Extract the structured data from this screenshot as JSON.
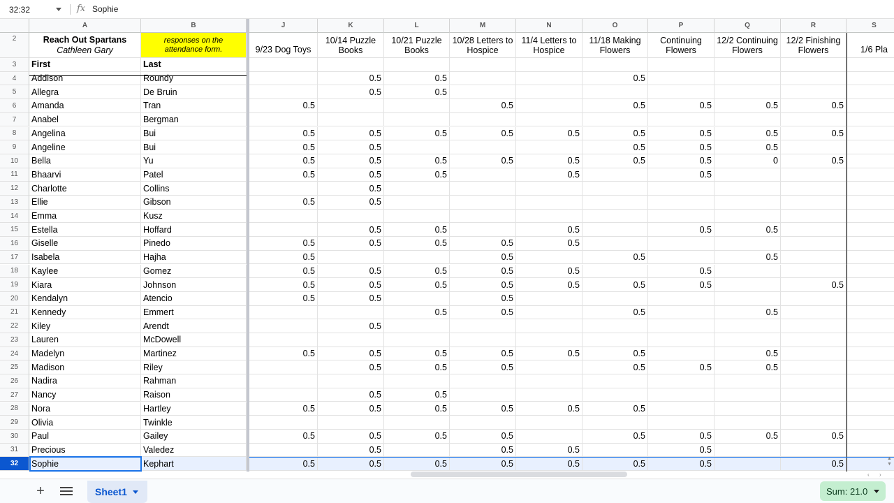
{
  "formula_bar": {
    "name_box": "32:32",
    "fx": "fx",
    "value": "Sophie"
  },
  "columns": [
    "A",
    "B",
    "J",
    "K",
    "L",
    "M",
    "N",
    "O",
    "P",
    "Q",
    "R",
    "S"
  ],
  "header_cells": {
    "a2_line1": "Reach Out Spartans",
    "a2_line2": "Cathleen Gary",
    "b2_line1": "responses on the",
    "b2_line2": "attendance form.",
    "events": [
      [
        "",
        "9/23 Dog Toys"
      ],
      [
        "10/14 Puzzle",
        "Books"
      ],
      [
        "10/21 Puzzle",
        "Books"
      ],
      [
        "10/28 Letters to",
        "Hospice"
      ],
      [
        "11/4 Letters to",
        "Hospice"
      ],
      [
        "11/18 Making",
        "Flowers"
      ],
      [
        "Continuing",
        "Flowers"
      ],
      [
        "12/2 Continuing",
        "Flowers"
      ],
      [
        "12/2 Finishing",
        "Flowers"
      ],
      [
        "",
        "1/6 Pla"
      ]
    ],
    "first_label": "First",
    "last_label": "Last"
  },
  "rows": [
    {
      "n": "4",
      "first": "Addison",
      "last": "Roundy",
      "v": [
        "",
        "0.5",
        "0.5",
        "",
        "",
        "0.5",
        "",
        "",
        ""
      ]
    },
    {
      "n": "5",
      "first": "Allegra",
      "last": "De Bruin",
      "v": [
        "",
        "0.5",
        "0.5",
        "",
        "",
        "",
        "",
        "",
        ""
      ]
    },
    {
      "n": "6",
      "first": "Amanda",
      "last": "Tran",
      "v": [
        "0.5",
        "",
        "",
        "0.5",
        "",
        "0.5",
        "0.5",
        "0.5",
        "0.5"
      ]
    },
    {
      "n": "7",
      "first": "Anabel",
      "last": "Bergman",
      "v": [
        "",
        "",
        "",
        "",
        "",
        "",
        "",
        "",
        ""
      ]
    },
    {
      "n": "8",
      "first": "Angelina",
      "last": "Bui",
      "v": [
        "0.5",
        "0.5",
        "0.5",
        "0.5",
        "0.5",
        "0.5",
        "0.5",
        "0.5",
        "0.5"
      ]
    },
    {
      "n": "9",
      "first": "Angeline",
      "last": "Bui",
      "v": [
        "0.5",
        "0.5",
        "",
        "",
        "",
        "0.5",
        "0.5",
        "0.5",
        ""
      ]
    },
    {
      "n": "10",
      "first": "Bella",
      "last": "Yu",
      "v": [
        "0.5",
        "0.5",
        "0.5",
        "0.5",
        "0.5",
        "0.5",
        "0.5",
        "0",
        "0.5"
      ]
    },
    {
      "n": "11",
      "first": "Bhaarvi",
      "last": "Patel",
      "v": [
        "0.5",
        "0.5",
        "0.5",
        "",
        "0.5",
        "",
        "0.5",
        "",
        ""
      ]
    },
    {
      "n": "12",
      "first": "Charlotte",
      "last": "Collins",
      "v": [
        "",
        "0.5",
        "",
        "",
        "",
        "",
        "",
        "",
        ""
      ]
    },
    {
      "n": "13",
      "first": "Ellie",
      "last": "Gibson",
      "v": [
        "0.5",
        "0.5",
        "",
        "",
        "",
        "",
        "",
        "",
        ""
      ]
    },
    {
      "n": "14",
      "first": "Emma",
      "last": "Kusz",
      "v": [
        "",
        "",
        "",
        "",
        "",
        "",
        "",
        "",
        ""
      ]
    },
    {
      "n": "15",
      "first": "Estella",
      "last": "Hoffard",
      "v": [
        "",
        "0.5",
        "0.5",
        "",
        "0.5",
        "",
        "0.5",
        "0.5",
        ""
      ]
    },
    {
      "n": "16",
      "first": "Giselle",
      "last": "Pinedo",
      "v": [
        "0.5",
        "0.5",
        "0.5",
        "0.5",
        "0.5",
        "",
        "",
        "",
        ""
      ]
    },
    {
      "n": "17",
      "first": "Isabela",
      "last": "Hajha",
      "v": [
        "0.5",
        "",
        "",
        "0.5",
        "",
        "0.5",
        "",
        "0.5",
        ""
      ]
    },
    {
      "n": "18",
      "first": "Kaylee",
      "last": "Gomez",
      "v": [
        "0.5",
        "0.5",
        "0.5",
        "0.5",
        "0.5",
        "",
        "0.5",
        "",
        ""
      ]
    },
    {
      "n": "19",
      "first": "Kiara",
      "last": "Johnson",
      "v": [
        "0.5",
        "0.5",
        "0.5",
        "0.5",
        "0.5",
        "0.5",
        "0.5",
        "",
        "0.5"
      ]
    },
    {
      "n": "20",
      "first": "Kendalyn",
      "last": "Atencio",
      "v": [
        "0.5",
        "0.5",
        "",
        "0.5",
        "",
        "",
        "",
        "",
        ""
      ]
    },
    {
      "n": "21",
      "first": "Kennedy",
      "last": "Emmert",
      "v": [
        "",
        "",
        "0.5",
        "0.5",
        "",
        "0.5",
        "",
        "0.5",
        ""
      ]
    },
    {
      "n": "22",
      "first": "Kiley",
      "last": "Arendt",
      "v": [
        "",
        "0.5",
        "",
        "",
        "",
        "",
        "",
        "",
        ""
      ]
    },
    {
      "n": "23",
      "first": "Lauren",
      "last": "McDowell",
      "v": [
        "",
        "",
        "",
        "",
        "",
        "",
        "",
        "",
        ""
      ]
    },
    {
      "n": "24",
      "first": "Madelyn",
      "last": "Martinez",
      "v": [
        "0.5",
        "0.5",
        "0.5",
        "0.5",
        "0.5",
        "0.5",
        "",
        "0.5",
        ""
      ]
    },
    {
      "n": "25",
      "first": "Madison",
      "last": "Riley",
      "v": [
        "",
        "0.5",
        "0.5",
        "0.5",
        "",
        "0.5",
        "0.5",
        "0.5",
        ""
      ]
    },
    {
      "n": "26",
      "first": "Nadira",
      "last": "Rahman",
      "v": [
        "",
        "",
        "",
        "",
        "",
        "",
        "",
        "",
        ""
      ]
    },
    {
      "n": "27",
      "first": "Nancy",
      "last": "Raison",
      "v": [
        "",
        "0.5",
        "0.5",
        "",
        "",
        "",
        "",
        "",
        ""
      ]
    },
    {
      "n": "28",
      "first": "Nora",
      "last": "Hartley",
      "v": [
        "0.5",
        "0.5",
        "0.5",
        "0.5",
        "0.5",
        "0.5",
        "",
        "",
        ""
      ]
    },
    {
      "n": "29",
      "first": "Olivia",
      "last": "Twinkle",
      "v": [
        "",
        "",
        "",
        "",
        "",
        "",
        "",
        "",
        ""
      ]
    },
    {
      "n": "30",
      "first": "Paul",
      "last": "Gailey",
      "v": [
        "0.5",
        "0.5",
        "0.5",
        "0.5",
        "",
        "0.5",
        "0.5",
        "0.5",
        "0.5"
      ]
    },
    {
      "n": "31",
      "first": "Precious",
      "last": "Valedez",
      "v": [
        "",
        "0.5",
        "",
        "0.5",
        "0.5",
        "",
        "0.5",
        "",
        ""
      ]
    },
    {
      "n": "32",
      "first": "Sophie",
      "last": "Kephart",
      "v": [
        "0.5",
        "0.5",
        "0.5",
        "0.5",
        "0.5",
        "0.5",
        "0.5",
        "",
        "0.5"
      ],
      "selected": true
    }
  ],
  "bottom": {
    "add_sheet": "+",
    "sheet_tab": "Sheet1",
    "sum": "Sum: 21.0"
  },
  "colors": {
    "accent": "#0b57d0",
    "highlight": "#ffff00",
    "sum_bg": "#c4eed0",
    "selection_bg": "#e8f0fe"
  }
}
